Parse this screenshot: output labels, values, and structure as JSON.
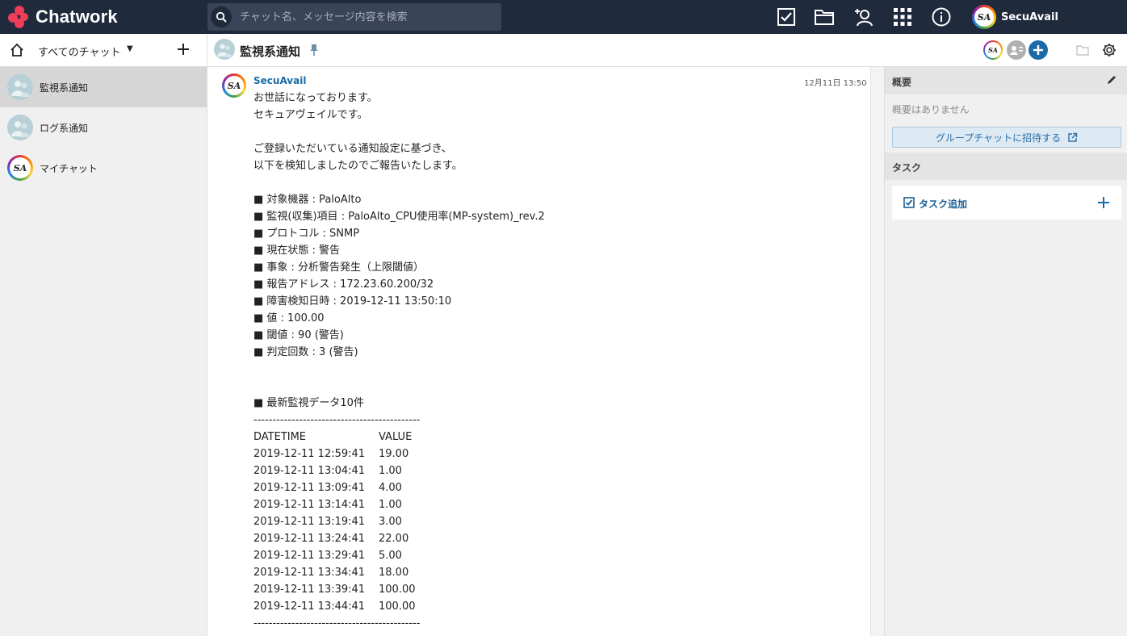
{
  "app": {
    "name": "Chatwork",
    "search_placeholder": "チャット名、メッセージ内容を検索",
    "user_name": "SecuAvail",
    "avatar_initials": "SA"
  },
  "sidebar": {
    "filter_label": "すべてのチャット",
    "rooms": [
      {
        "name": "監視系通知",
        "active": true
      },
      {
        "name": "ログ系通知",
        "active": false
      },
      {
        "name": "マイチャット",
        "active": false
      }
    ]
  },
  "room": {
    "title": "監視系通知"
  },
  "message": {
    "sender": "SecuAvail",
    "time": "12月11日 13:50",
    "lines": [
      "お世話になっております。",
      "セキュアヴェイルです。",
      "",
      "ご登録いただいている通知設定に基づき、",
      "以下を検知しましたのでご報告いたします。",
      "",
      "■ 対象機器 : PaloAlto",
      "■ 監視(収集)項目 : PaloAlto_CPU使用率(MP-system)_rev.2",
      "■ プロトコル : SNMP",
      "■ 現在状態 : 警告",
      "■ 事象 : 分析警告発生（上限閾値）",
      "■ 報告アドレス : 172.23.60.200/32",
      "■ 障害検知日時 : 2019-12-11 13:50:10",
      "■ 値 : 100.00",
      "■ 閾値 : 90 (警告)",
      "■ 判定回数 : 3 (警告)",
      "",
      "",
      "■ 最新監視データ10件",
      "--------------------------------------------"
    ],
    "data_header": {
      "datetime": "DATETIME",
      "value": "VALUE"
    },
    "data_rows": [
      {
        "datetime": "2019-12-11 12:59:41",
        "value": "19.00"
      },
      {
        "datetime": "2019-12-11 13:04:41",
        "value": "1.00"
      },
      {
        "datetime": "2019-12-11 13:09:41",
        "value": "4.00"
      },
      {
        "datetime": "2019-12-11 13:14:41",
        "value": "1.00"
      },
      {
        "datetime": "2019-12-11 13:19:41",
        "value": "3.00"
      },
      {
        "datetime": "2019-12-11 13:24:41",
        "value": "22.00"
      },
      {
        "datetime": "2019-12-11 13:29:41",
        "value": "5.00"
      },
      {
        "datetime": "2019-12-11 13:34:41",
        "value": "18.00"
      },
      {
        "datetime": "2019-12-11 13:39:41",
        "value": "100.00"
      },
      {
        "datetime": "2019-12-11 13:44:41",
        "value": "100.00"
      }
    ],
    "footer_line": "--------------------------------------------"
  },
  "right_panel": {
    "summary_title": "概要",
    "summary_empty": "概要はありません",
    "invite_label": "グループチャットに招待する",
    "task_title": "タスク",
    "task_add_label": "タスク追加"
  },
  "colors": {
    "topbar": "#1f2a3d",
    "brand_red": "#ef3d58",
    "accent_blue": "#1a6ba8",
    "add_button": "#1a6ba8"
  }
}
